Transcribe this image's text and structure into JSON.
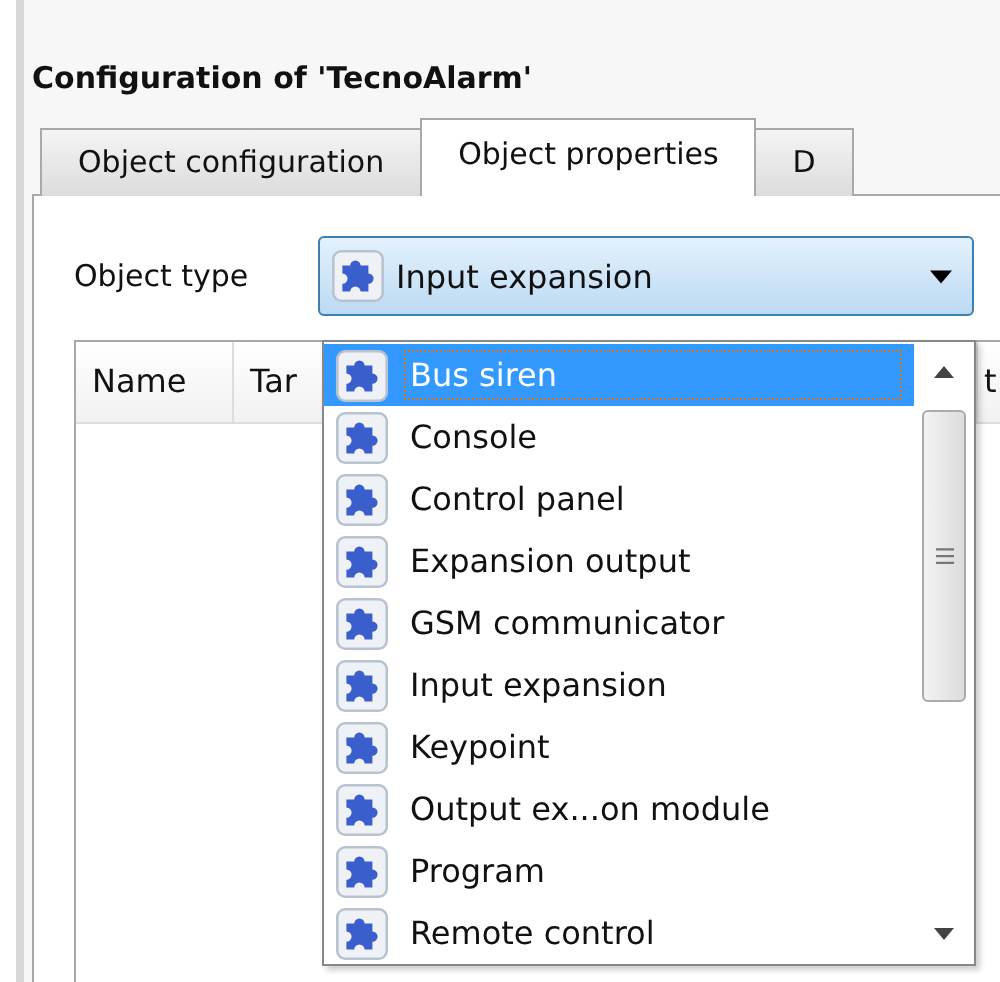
{
  "window": {
    "title": "Configuration of 'TecnoAlarm'"
  },
  "tabs": [
    {
      "label": "Object configuration",
      "selected": false
    },
    {
      "label": "Object properties",
      "selected": true
    },
    {
      "label": "D",
      "selected": false
    }
  ],
  "object_type": {
    "label": "Object type",
    "value": "Input expansion",
    "expanded": true
  },
  "table": {
    "columns": [
      "Name",
      "Tar",
      "t"
    ]
  },
  "dropdown": {
    "items": [
      {
        "label": "Bus siren",
        "selected": true
      },
      {
        "label": "Console",
        "selected": false
      },
      {
        "label": "Control panel",
        "selected": false
      },
      {
        "label": "Expansion output",
        "selected": false
      },
      {
        "label": "GSM communicator",
        "selected": false
      },
      {
        "label": "Input expansion",
        "selected": false
      },
      {
        "label": "Keypoint",
        "selected": false
      },
      {
        "label": "Output ex...on module",
        "selected": false
      },
      {
        "label": "Program",
        "selected": false
      },
      {
        "label": "Remote control",
        "selected": false
      }
    ]
  }
}
